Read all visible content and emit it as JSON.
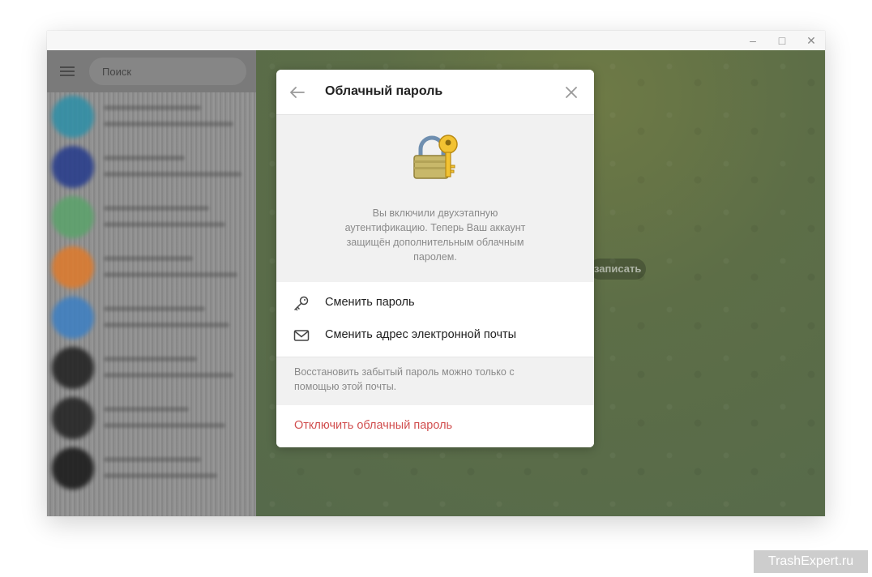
{
  "window": {
    "controls": {
      "minimize": "–",
      "maximize": "□",
      "close": "✕"
    }
  },
  "sidebar": {
    "search_placeholder": "Поиск",
    "chats": [
      {
        "avatar_color": "#2c8fa8"
      },
      {
        "avatar_color": "#243a8c"
      },
      {
        "avatar_color": "#5aa36a"
      },
      {
        "avatar_color": "#e07a2a"
      },
      {
        "avatar_color": "#3b7fc4"
      },
      {
        "avatar_color": "#1e1e1e"
      },
      {
        "avatar_color": "#202020"
      },
      {
        "avatar_color": "#151515"
      }
    ]
  },
  "background": {
    "pill_text": "записать"
  },
  "dialog": {
    "title": "Облачный пароль",
    "info_text": "Вы включили двухэтапную аутентификацию. Теперь Ваш аккаунт защищён дополнительным облачным паролем.",
    "actions": [
      {
        "label": "Сменить пароль",
        "icon": "key-icon"
      },
      {
        "label": "Сменить адрес электронной почты",
        "icon": "mail-icon"
      }
    ],
    "hint": "Восстановить забытый пароль можно только с помощью этой почты.",
    "danger_label": "Отключить облачный пароль",
    "colors": {
      "danger": "#d14e4e",
      "muted": "#8a8a8a"
    }
  },
  "watermark": "TrashExpert.ru"
}
